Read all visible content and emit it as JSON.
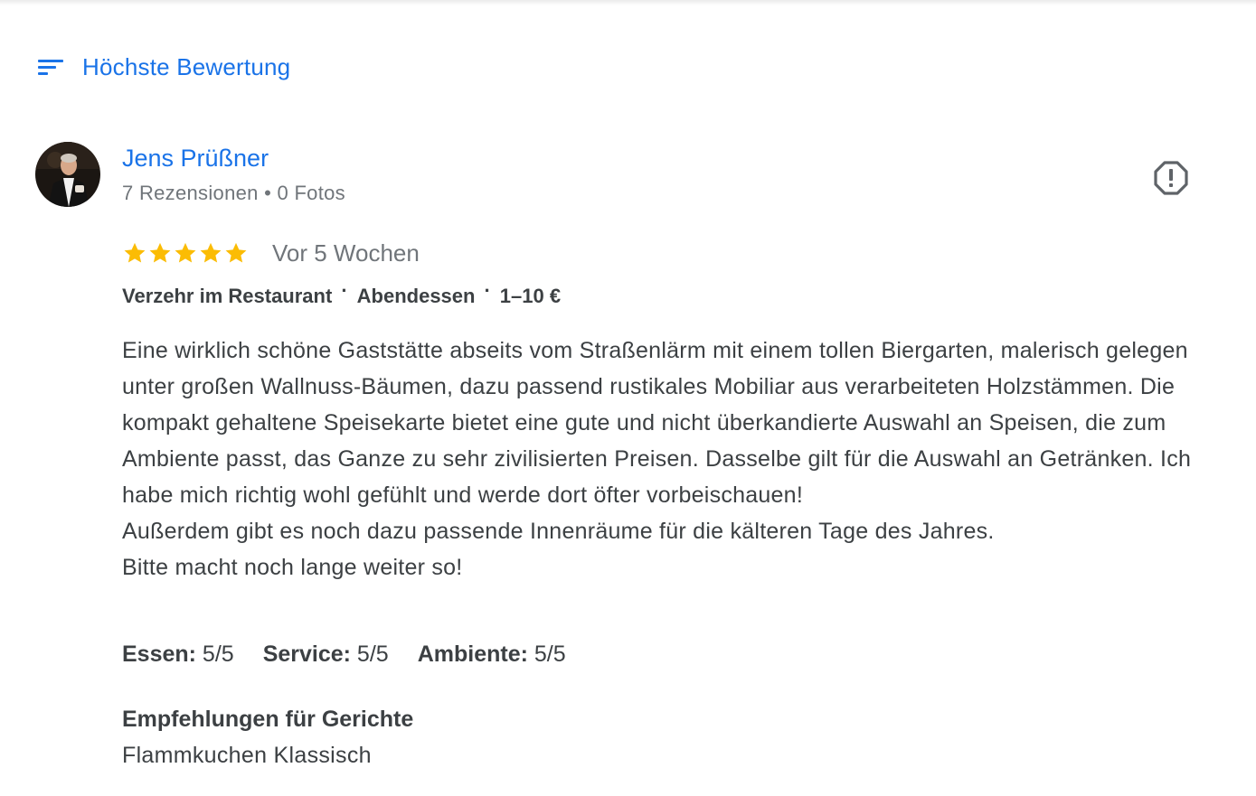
{
  "sort": {
    "icon": "sort-lines-icon",
    "label": "Höchste Bewertung"
  },
  "review": {
    "reviewer": {
      "name": "Jens Prüßner",
      "meta": "7 Rezensionen • 0 Fotos",
      "avatar_icon": "user-avatar-photo"
    },
    "report_icon": "report-flag-icon",
    "rating": 5,
    "rating_max": 5,
    "time": "Vor 5 Wochen",
    "tags": [
      "Verzehr im Restaurant",
      "Abendessen",
      "1–10 €"
    ],
    "tag_separator": "·",
    "text": "Eine wirklich schöne Gaststätte abseits vom Straßenlärm mit einem tollen Biergarten, malerisch gelegen unter großen Wallnuss-Bäumen, dazu passend rustikales Mobiliar aus verarbeiteten Holzstämmen. Die kompakt gehaltene Speisekarte bietet eine gute und nicht überkandierte Auswahl an Speisen, die zum Ambiente passt, das Ganze zu sehr zivilisierten Preisen. Dasselbe gilt für die Auswahl an Getränken. Ich habe mich richtig wohl gefühlt und werde dort öfter vorbeischauen!\nAußerdem gibt es noch dazu passende Innenräume für die kälteren Tage des Jahres.\nBitte macht noch lange weiter so!",
    "sub_ratings": [
      {
        "label": "Essen:",
        "value": "5/5"
      },
      {
        "label": "Service:",
        "value": "5/5"
      },
      {
        "label": "Ambiente:",
        "value": "5/5"
      }
    ],
    "dishes_title": "Empfehlungen für Gerichte",
    "dishes_value": "Flammkuchen Klassisch"
  },
  "colors": {
    "accent": "#1a73e8",
    "star": "#fbbc04",
    "secondary_text": "#70757a",
    "primary_text": "#3c4043"
  }
}
